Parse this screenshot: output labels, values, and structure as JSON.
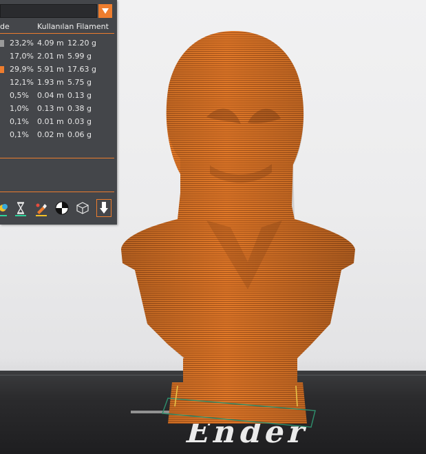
{
  "panel": {
    "dropdown_value": "",
    "header": {
      "col1": "de",
      "col2": "Kullanılan Filament"
    },
    "rows": [
      {
        "pct": "23,2%",
        "len": "4.09 m",
        "wt": "12.20 g",
        "swatch": "#9a9a9a"
      },
      {
        "pct": "17,0%",
        "len": "2.01 m",
        "wt": "5.99 g",
        "swatch": ""
      },
      {
        "pct": "29,9%",
        "len": "5.91 m",
        "wt": "17.63 g",
        "swatch": "#ee7d2e"
      },
      {
        "pct": "12,1%",
        "len": "1.93 m",
        "wt": "5.75 g",
        "swatch": ""
      },
      {
        "pct": "0,5%",
        "len": "0.04 m",
        "wt": "0.13 g",
        "swatch": ""
      },
      {
        "pct": "1,0%",
        "len": "0.13 m",
        "wt": "0.38 g",
        "swatch": ""
      },
      {
        "pct": "0,1%",
        "len": "0.01 m",
        "wt": "0.03 g",
        "swatch": ""
      },
      {
        "pct": "0,1%",
        "len": "0.02 m",
        "wt": "0.06 g",
        "swatch": ""
      }
    ],
    "toolbar": [
      {
        "icon": "color-print-icon"
      },
      {
        "icon": "hourglass-icon"
      },
      {
        "icon": "paint-brush-icon"
      },
      {
        "icon": "checker-circle-icon"
      },
      {
        "icon": "wireframe-cube-icon"
      },
      {
        "icon": "export-down-arrow-icon"
      }
    ]
  },
  "viewport": {
    "bed_logo_text": "Ender",
    "model_color": "#e07828",
    "accent": "#ee7d2e"
  }
}
